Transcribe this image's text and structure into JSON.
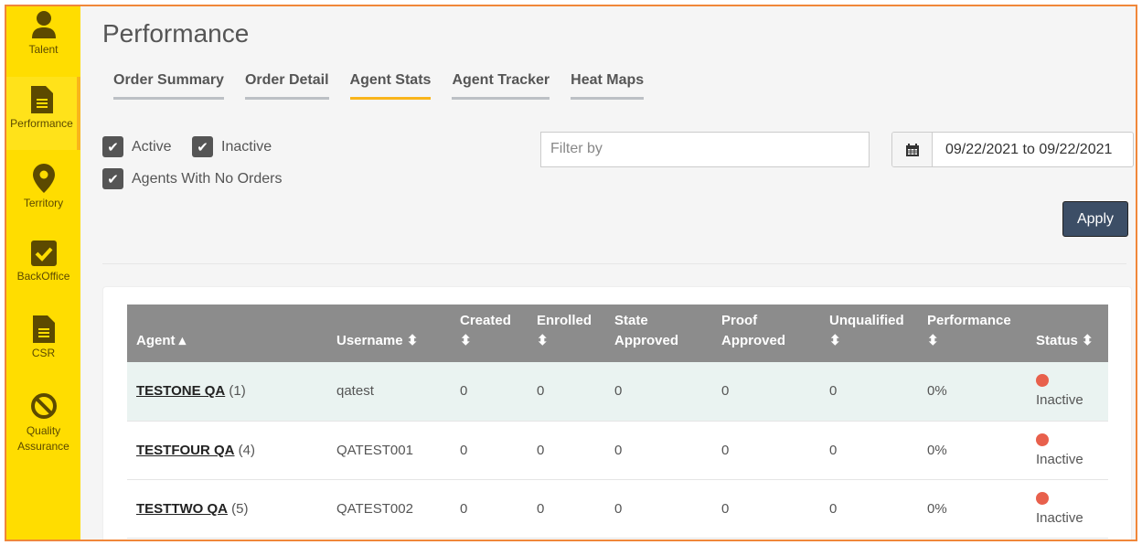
{
  "sidebar": {
    "items": [
      {
        "label": "Talent",
        "icon": "user-icon"
      },
      {
        "label": "Performance",
        "icon": "document-icon",
        "active": true
      },
      {
        "label": "Territory",
        "icon": "map-pin-icon"
      },
      {
        "label": "BackOffice",
        "icon": "checkbox-icon"
      },
      {
        "label": "CSR",
        "icon": "file-icon"
      },
      {
        "label": "Quality Assurance",
        "icon": "ban-icon"
      }
    ]
  },
  "page": {
    "title": "Performance"
  },
  "tabs": [
    {
      "label": "Order Summary"
    },
    {
      "label": "Order Detail"
    },
    {
      "label": "Agent Stats",
      "active": true
    },
    {
      "label": "Agent Tracker"
    },
    {
      "label": "Heat Maps"
    }
  ],
  "filters": {
    "active": "Active",
    "inactive": "Inactive",
    "no_orders": "Agents With No Orders",
    "filter_placeholder": "Filter by",
    "date_range": "09/22/2021 to 09/22/2021",
    "apply": "Apply"
  },
  "table": {
    "headers": [
      "Agent",
      "Username",
      "Created",
      "Enrolled",
      "State Approved",
      "Proof Approved",
      "Unqualified",
      "Performance",
      "Status"
    ],
    "rows": [
      {
        "agent": "TESTONE QA",
        "count": "(1)",
        "username": "qatest",
        "created": "0",
        "enrolled": "0",
        "state": "0",
        "proof": "0",
        "unqualified": "0",
        "performance": "0%",
        "status": "Inactive"
      },
      {
        "agent": "TESTFOUR QA",
        "count": "(4)",
        "username": "QATEST001",
        "created": "0",
        "enrolled": "0",
        "state": "0",
        "proof": "0",
        "unqualified": "0",
        "performance": "0%",
        "status": "Inactive"
      },
      {
        "agent": "TESTTWO QA",
        "count": "(5)",
        "username": "QATEST002",
        "created": "0",
        "enrolled": "0",
        "state": "0",
        "proof": "0",
        "unqualified": "0",
        "performance": "0%",
        "status": "Inactive"
      }
    ]
  },
  "colors": {
    "sidebar": "#ffdd00",
    "accent": "#f9b51b",
    "apply": "#3c4e66",
    "inactive_dot": "#e8604c"
  }
}
